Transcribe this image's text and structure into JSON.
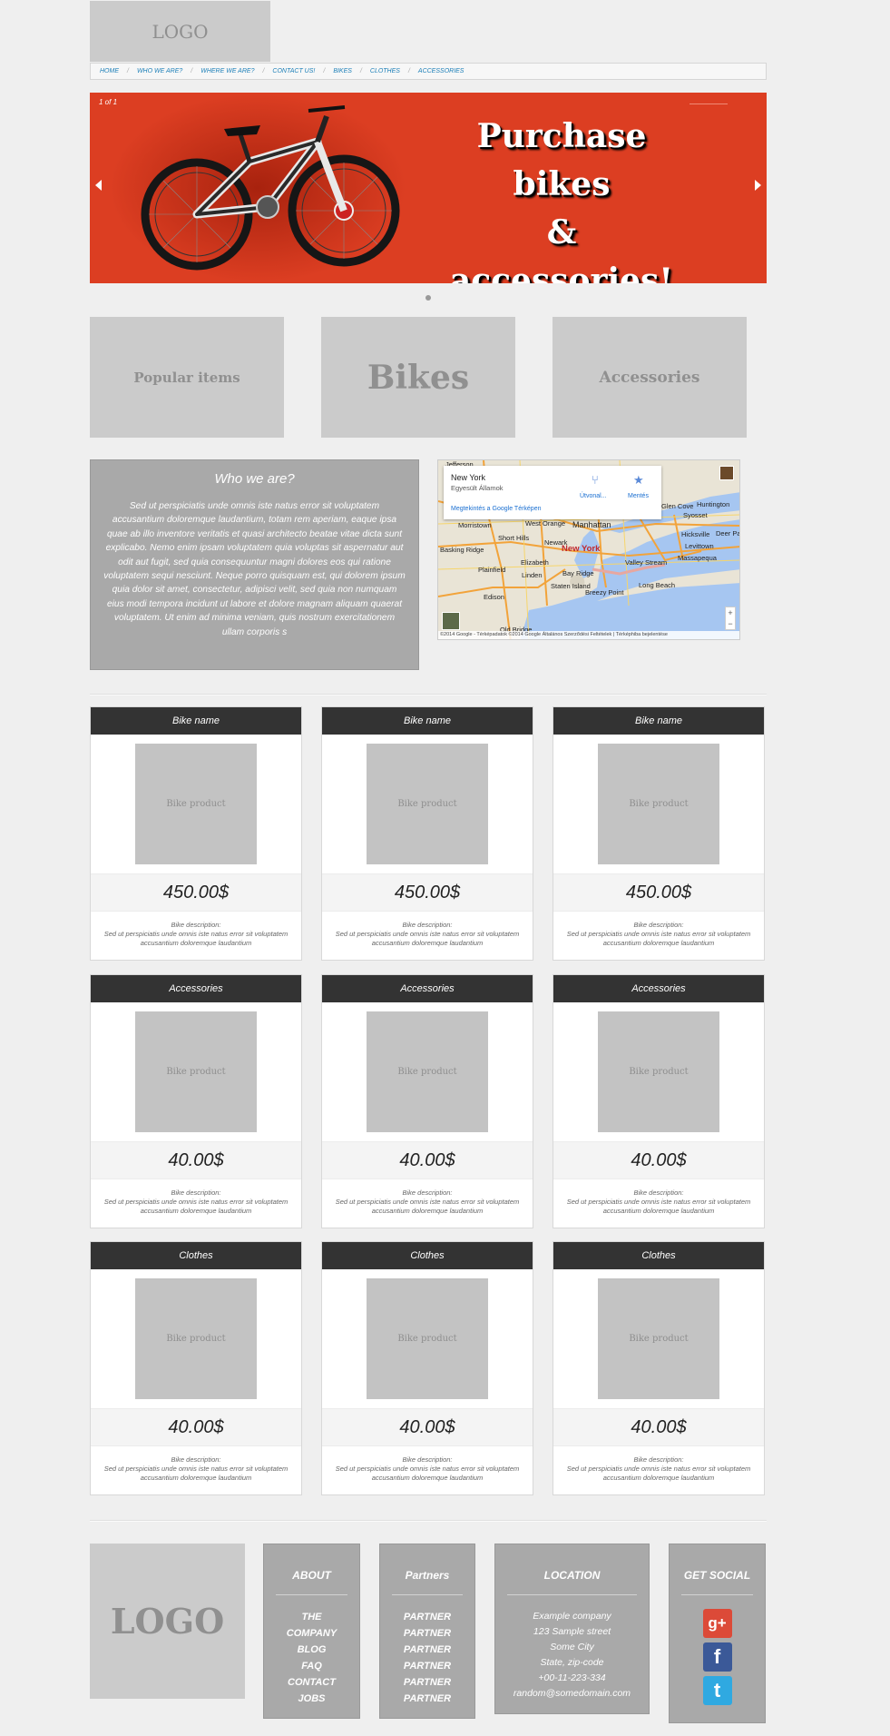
{
  "header": {
    "logo": "LOGO"
  },
  "nav": {
    "items": [
      "HOME",
      "WHO WE ARE?",
      "WHERE WE ARE?",
      "CONTACT US!",
      "BIKES",
      "CLOTHES",
      "ACCESSORIES"
    ]
  },
  "slider": {
    "counter": "1 of 1",
    "title_lines": [
      "Purchase bikes",
      "&",
      "accessories!"
    ],
    "bg_color": "#dc3e22"
  },
  "categories": [
    "Popular items",
    "Bikes",
    "Accessories"
  ],
  "who": {
    "title": "Who we are?",
    "text": "Sed ut perspiciatis unde omnis iste natus error sit voluptatem accusantium doloremque laudantium, totam rem aperiam, eaque ipsa quae ab illo inventore veritatis et quasi architecto beatae vitae dicta sunt explicabo. Nemo enim ipsam voluptatem quia voluptas sit aspernatur aut odit aut fugit, sed quia consequuntur magni dolores eos qui ratione voluptatem sequi nesciunt. Neque porro quisquam est, qui dolorem ipsum quia dolor sit amet, consectetur, adipisci velit, sed quia non numquam eius modi tempora incidunt ut labore et dolore magnam aliquam quaerat voluptatem. Ut enim ad minima veniam, quis nostrum exercitationem ullam corporis s"
  },
  "map": {
    "place": "New York",
    "country": "Egyesült Államok",
    "route_label": "Útvonal...",
    "save_label": "Mentés",
    "view_link": "Megtekintés a Google Térképen",
    "footer": "©2014 Google - Térképadatok ©2014 Google Általános Szerződési Feltételek | Térképhiba bejelentése",
    "labels": [
      "Jefferson",
      "Morristown",
      "West Orange",
      "Manhattan",
      "Glen Cove",
      "Huntington",
      "Syosset",
      "Short Hills",
      "Newark",
      "New York",
      "Hicksville",
      "Basking Ridge",
      "Elizabeth",
      "Bay Ridge",
      "Valley Stream",
      "Levittown",
      "Deer Park",
      "Massapequa",
      "Plainfield",
      "Linden",
      "Staten Island",
      "Long Beach",
      "Edison",
      "Breezy Point",
      "Old Bridge"
    ]
  },
  "products": {
    "description_label": "Bike description:",
    "description_text": "Sed ut perspiciatis unde omnis iste natus error sit voluptatem accusantium doloremque laudantium",
    "image_label": "Bike product",
    "rows": [
      {
        "title": "Bike name",
        "price": "450.00$"
      },
      {
        "title": "Accessories",
        "price": "40.00$"
      },
      {
        "title": "Clothes",
        "price": "40.00$"
      }
    ]
  },
  "footer": {
    "logo": "LOGO",
    "about": {
      "title": "ABOUT",
      "items": [
        "THE",
        "COMPANY",
        "BLOG",
        "FAQ",
        "CONTACT",
        "JOBS"
      ]
    },
    "partners": {
      "title": "Partners",
      "items": [
        "PARTNER",
        "PARTNER",
        "PARTNER",
        "PARTNER",
        "PARTNER",
        "PARTNER"
      ]
    },
    "location": {
      "title": "LOCATION",
      "lines": [
        "Example company",
        "123 Sample street",
        "Some City",
        "State, zip-code",
        "+00-11-223-334",
        "random@somedomain.com"
      ]
    },
    "social": {
      "title": "GET SOCIAL",
      "icons": [
        {
          "name": "google-plus-icon",
          "glyph": "g+",
          "color": "#dc4a38"
        },
        {
          "name": "facebook-icon",
          "glyph": "f",
          "color": "#3b5998"
        },
        {
          "name": "twitter-icon",
          "glyph": "t",
          "color": "#2fa9e1"
        }
      ]
    }
  }
}
